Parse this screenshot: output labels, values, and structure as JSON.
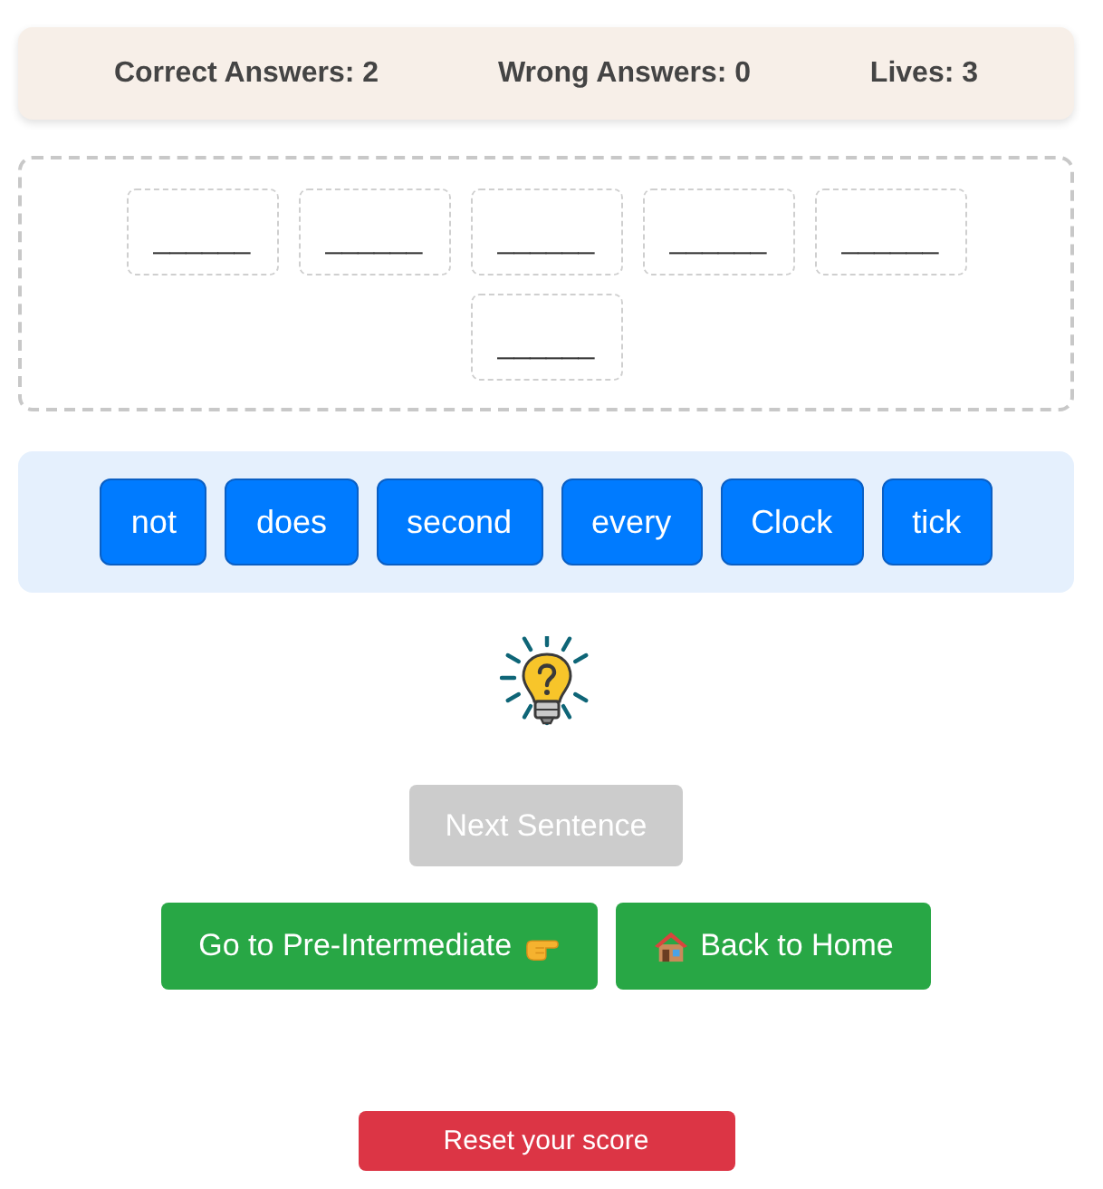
{
  "score_items": [
    "Correct Answers: 2",
    "Wrong Answers: 0",
    "Lives: 3"
  ],
  "answer_slots": [
    {
      "text": "______"
    },
    {
      "text": "______"
    },
    {
      "text": "______"
    },
    {
      "text": "______"
    },
    {
      "text": "______"
    },
    {
      "text": "______"
    }
  ],
  "word_bank": [
    "not",
    "does",
    "second",
    "every",
    "Clock",
    "tick"
  ],
  "next_button": {
    "label": "Next Sentence",
    "disabled": true
  },
  "nav_buttons": [
    {
      "kind": "next-level",
      "label": "Go to Pre-Intermediate"
    },
    {
      "kind": "home",
      "label": "Back to Home"
    }
  ],
  "reset_button": {
    "label": "Reset your score"
  }
}
